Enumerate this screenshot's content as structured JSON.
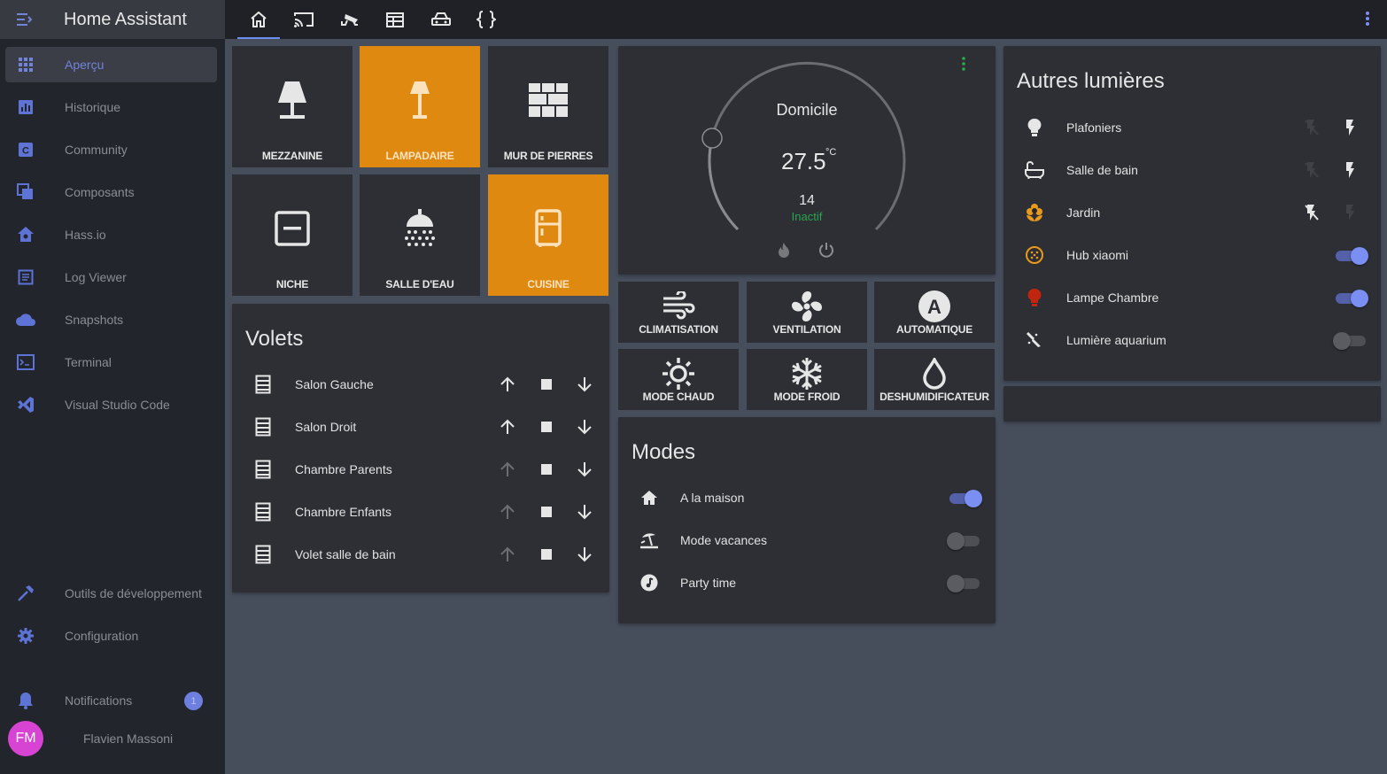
{
  "app": {
    "title": "Home Assistant"
  },
  "sidebar": {
    "items": [
      {
        "label": "Aperçu",
        "icon": "apps-grid-icon"
      },
      {
        "label": "Historique",
        "icon": "chart-bar-icon"
      },
      {
        "label": "Community",
        "icon": "community-icon"
      },
      {
        "label": "Composants",
        "icon": "layers-icon"
      },
      {
        "label": "Hass.io",
        "icon": "hassio-icon"
      },
      {
        "label": "Log Viewer",
        "icon": "file-document-icon"
      },
      {
        "label": "Snapshots",
        "icon": "cloud-icon"
      },
      {
        "label": "Terminal",
        "icon": "console-icon"
      },
      {
        "label": "Visual Studio Code",
        "icon": "vscode-icon"
      }
    ],
    "dev_tools": "Outils de développement",
    "configuration": "Configuration",
    "notifications": "Notifications",
    "notification_count": "1",
    "user_name": "Flavien Massoni",
    "user_initials": "FM"
  },
  "tabs": [
    {
      "icon": "home-icon"
    },
    {
      "icon": "cast-icon"
    },
    {
      "icon": "cctv-icon"
    },
    {
      "icon": "calendar-icon"
    },
    {
      "icon": "car-icon"
    },
    {
      "icon": "code-braces-icon"
    }
  ],
  "tiles": [
    {
      "label": "MEZZANINE",
      "state": "off",
      "icon": "floor-lamp-icon"
    },
    {
      "label": "LAMPADAIRE",
      "state": "on",
      "icon": "lamp-icon"
    },
    {
      "label": "MUR DE PIERRES",
      "state": "off",
      "icon": "wall-icon"
    },
    {
      "label": "NICHE",
      "state": "off",
      "icon": "niche-icon"
    },
    {
      "label": "SALLE D'EAU",
      "state": "off",
      "icon": "shower-icon"
    },
    {
      "label": "CUISINE",
      "state": "on",
      "icon": "fridge-icon"
    }
  ],
  "volets": {
    "title": "Volets",
    "items": [
      {
        "label": "Salon Gauche",
        "up_enabled": true
      },
      {
        "label": "Salon Droit",
        "up_enabled": true
      },
      {
        "label": "Chambre Parents",
        "up_enabled": false
      },
      {
        "label": "Chambre Enfants",
        "up_enabled": false
      },
      {
        "label": "Volet salle de bain",
        "up_enabled": false
      }
    ]
  },
  "thermostat": {
    "name": "Domicile",
    "temperature": "27.5",
    "unit": "°C",
    "setpoint": "14",
    "state": "Inactif"
  },
  "climate_buttons": [
    {
      "label": "CLIMATISATION",
      "icon": "air-conditioner-icon"
    },
    {
      "label": "VENTILATION",
      "icon": "fan-icon"
    },
    {
      "label": "AUTOMATIQUE",
      "icon": "auto-icon"
    },
    {
      "label": "MODE CHAUD",
      "icon": "sun-icon"
    },
    {
      "label": "MODE FROID",
      "icon": "snowflake-icon"
    },
    {
      "label": "DESHUMIDIFICATEUR",
      "icon": "water-drop-icon"
    }
  ],
  "modes": {
    "title": "Modes",
    "items": [
      {
        "label": "A la maison",
        "icon": "home-icon",
        "on": true
      },
      {
        "label": "Mode vacances",
        "icon": "beach-icon",
        "on": false
      },
      {
        "label": "Party time",
        "icon": "music-icon",
        "on": false
      }
    ]
  },
  "lights": {
    "title": "Autres lumières",
    "items": [
      {
        "label": "Plafoniers",
        "icon": "lightbulb-icon",
        "control": "flash"
      },
      {
        "label": "Salle de bain",
        "icon": "bathtub-icon",
        "control": "flash"
      },
      {
        "label": "Jardin",
        "icon": "flower-icon",
        "control": "flash"
      },
      {
        "label": "Hub xiaomi",
        "icon": "hub-icon",
        "control": "toggle",
        "on": true
      },
      {
        "label": "Lampe Chambre",
        "icon": "bulb-red-icon",
        "control": "toggle",
        "on": true
      },
      {
        "label": "Lumière aquarium",
        "icon": "aquarium-icon",
        "control": "toggle",
        "on": false
      }
    ]
  },
  "colors": {
    "accent": "#7b8ef1",
    "tile_on": "#df8910",
    "sidebar_active": "#7283da"
  }
}
